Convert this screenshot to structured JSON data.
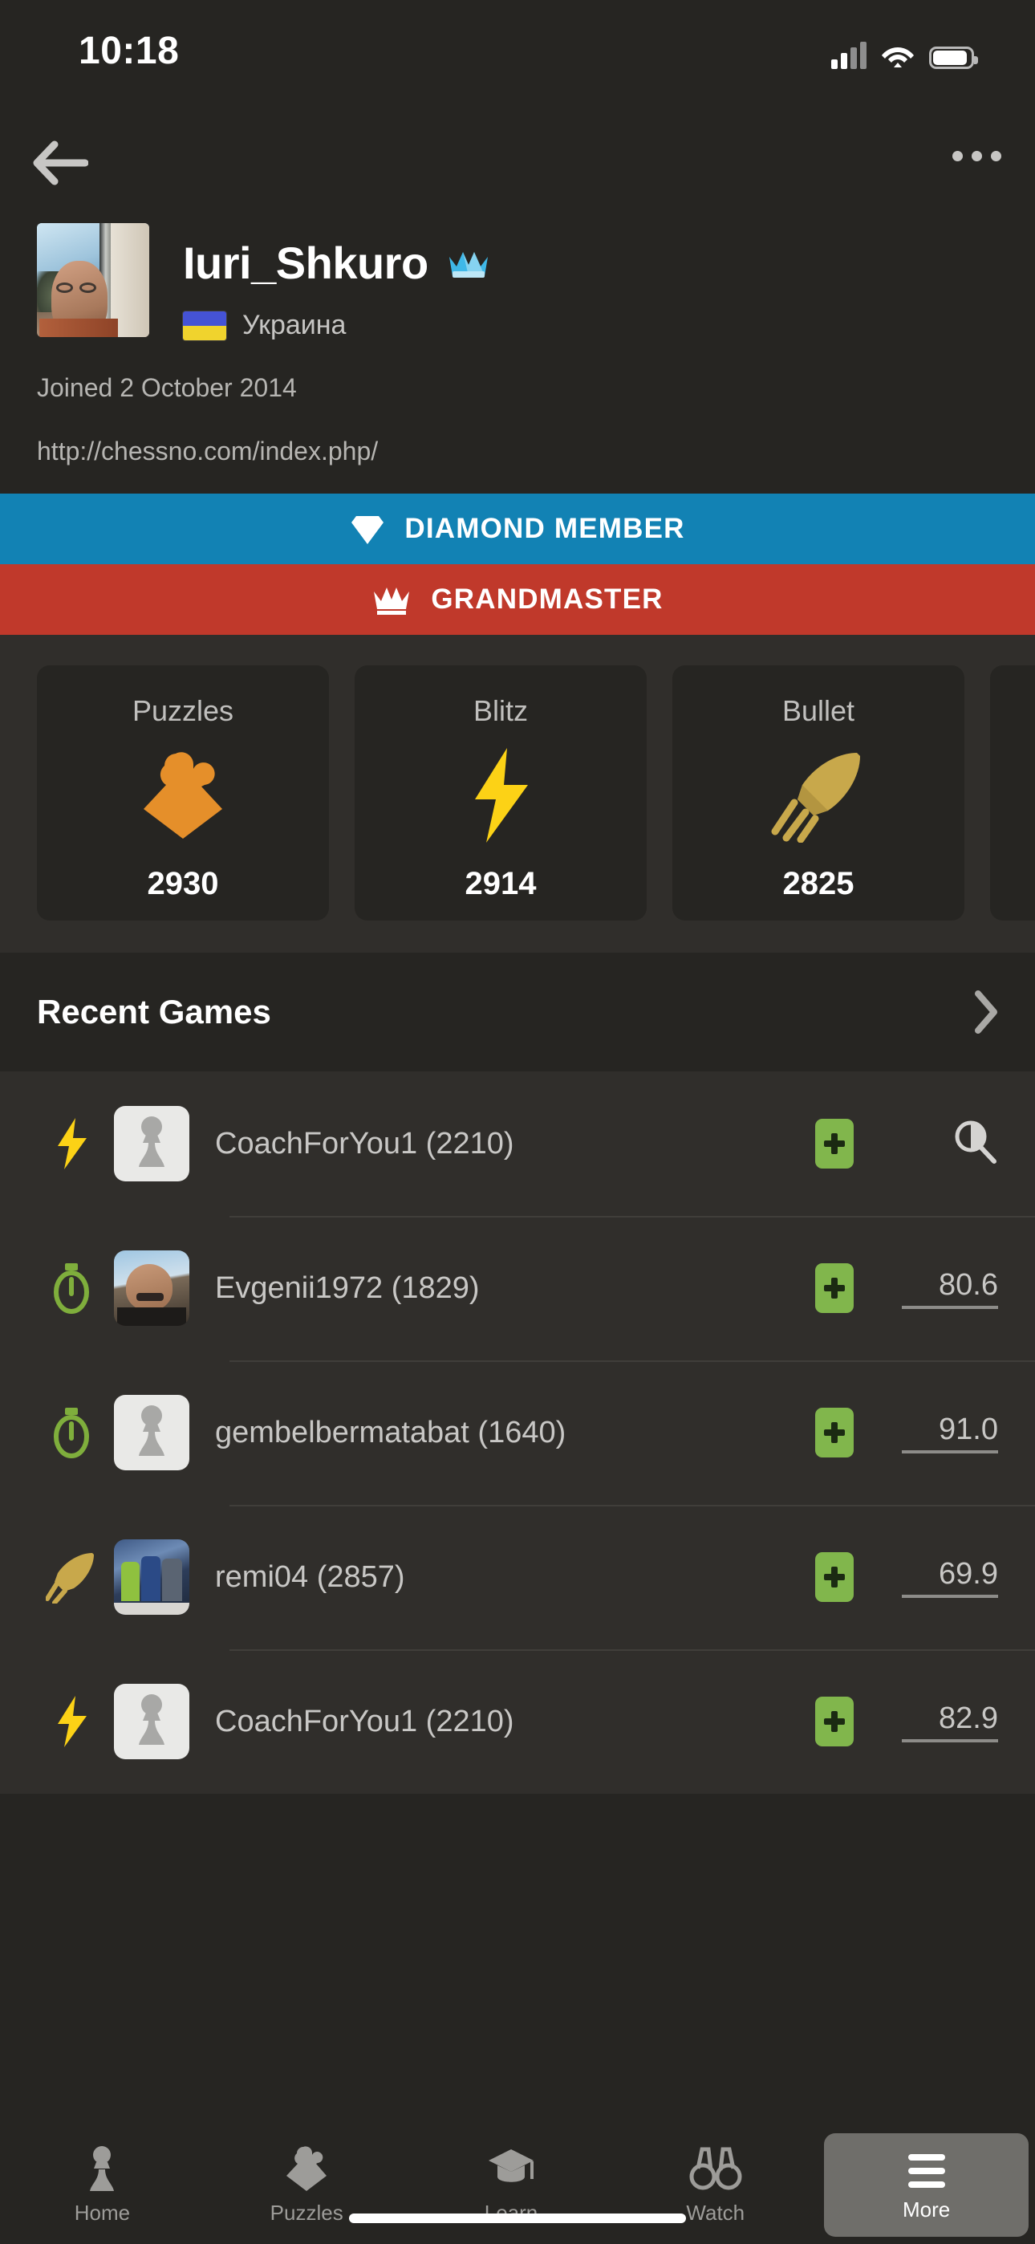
{
  "status_bar": {
    "time": "10:18",
    "cellular_icon": "cellular-signal-icon",
    "wifi_icon": "wifi-icon",
    "battery_icon": "battery-icon"
  },
  "nav": {
    "back_icon": "back-arrow-icon",
    "more_icon": "overflow-menu-icon"
  },
  "profile": {
    "avatar": "profile-photo",
    "username": "Iuri_Shkuro",
    "badge_icon": "blue-crown-icon",
    "flag": "ukraine-flag-icon",
    "country": "Украина",
    "joined": "Joined 2 October 2014",
    "website": "http://chessno.com/index.php/"
  },
  "memberships": [
    {
      "label": "DIAMOND MEMBER",
      "icon": "diamond-icon",
      "color": "#1282b4"
    },
    {
      "label": "GRANDMASTER",
      "icon": "crown-icon",
      "color": "#c0392b"
    }
  ],
  "stats": [
    {
      "label": "Puzzles",
      "icon": "puzzle-piece-icon",
      "value": "2930",
      "color": "#e58f2a"
    },
    {
      "label": "Blitz",
      "icon": "lightning-bolt-icon",
      "value": "2914",
      "color": "#fcd216"
    },
    {
      "label": "Bullet",
      "icon": "rocket-icon",
      "value": "2825",
      "color": "#c8a84b"
    },
    {
      "label": "",
      "icon": "",
      "value": "",
      "color": ""
    }
  ],
  "recent_games": {
    "title": "Recent Games",
    "chevron_icon": "chevron-right-icon",
    "rows": [
      {
        "time_class_icon": "lightning-bolt-icon",
        "avatar": "pawn-placeholder-avatar",
        "opponent": "CoachForYou1 (2210)",
        "plus_icon": "add-friend-icon",
        "accuracy": "",
        "trailing_icon": "game-review-magnifier-icon"
      },
      {
        "time_class_icon": "stopwatch-icon",
        "avatar": "opponent-photo-avatar",
        "opponent": "Evgenii1972 (1829)",
        "plus_icon": "add-friend-icon",
        "accuracy": "80.6",
        "trailing_icon": ""
      },
      {
        "time_class_icon": "stopwatch-icon",
        "avatar": "pawn-placeholder-avatar",
        "opponent": "gembelbermatabat (1640)",
        "plus_icon": "add-friend-icon",
        "accuracy": "91.0",
        "trailing_icon": ""
      },
      {
        "time_class_icon": "rocket-icon",
        "avatar": "opponent-photo-avatar",
        "opponent": "remi04 (2857)",
        "plus_icon": "add-friend-icon",
        "accuracy": "69.9",
        "trailing_icon": ""
      },
      {
        "time_class_icon": "lightning-bolt-icon",
        "avatar": "pawn-placeholder-avatar",
        "opponent": "CoachForYou1 (2210)",
        "plus_icon": "add-friend-icon",
        "accuracy": "82.9",
        "trailing_icon": ""
      }
    ]
  },
  "tab_bar": {
    "active": "More",
    "tabs": [
      {
        "label": "Home",
        "icon": "pawn-icon"
      },
      {
        "label": "Puzzles",
        "icon": "puzzle-piece-icon"
      },
      {
        "label": "Learn",
        "icon": "graduation-cap-icon"
      },
      {
        "label": "Watch",
        "icon": "binoculars-icon"
      },
      {
        "label": "More",
        "icon": "hamburger-menu-icon"
      }
    ]
  }
}
